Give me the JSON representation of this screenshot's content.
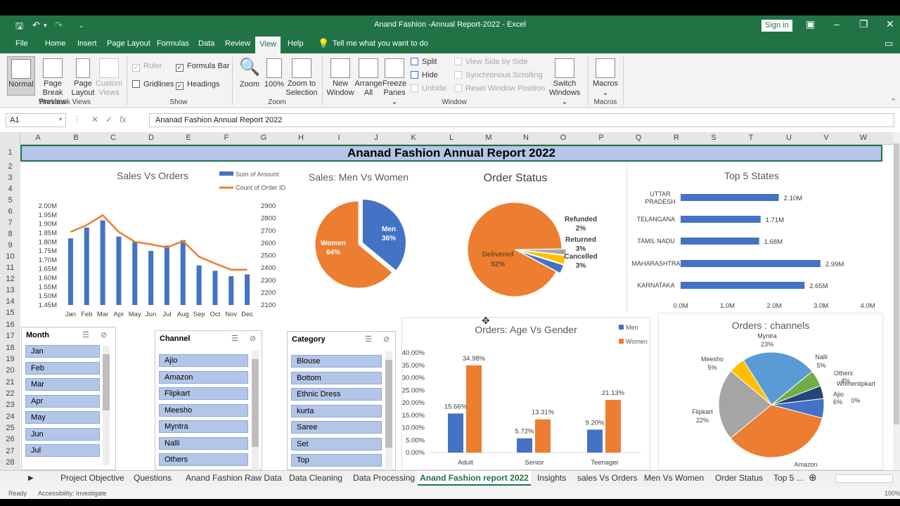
{
  "window": {
    "title": "Anand Fashion -Annual Report-2022  -  Excel",
    "sign_in": "Sign in"
  },
  "ribbon_tabs": [
    "File",
    "Home",
    "Insert",
    "Page Layout",
    "Formulas",
    "Data",
    "Review",
    "View",
    "Help"
  ],
  "tell_me": "Tell me what you want to do",
  "ribbon": {
    "normal": "Normal",
    "page_break_1": "Page Break",
    "page_break_2": "Preview",
    "page_layout_1": "Page",
    "page_layout_2": "Layout",
    "custom_views_1": "Custom",
    "custom_views_2": "Views",
    "workbook_views": "Workbook Views",
    "ruler": "Ruler",
    "formula_bar": "Formula Bar",
    "gridlines": "Gridlines",
    "headings": "Headings",
    "show": "Show",
    "zoom": "Zoom",
    "zoom100": "100%",
    "zoom_sel_1": "Zoom to",
    "zoom_sel_2": "Selection",
    "zoom_group": "Zoom",
    "new_window_1": "New",
    "new_window_2": "Window",
    "arrange_1": "Arrange",
    "arrange_2": "All",
    "freeze_1": "Freeze",
    "freeze_2": "Panes ⌄",
    "split": "Split",
    "hide": "Hide",
    "unhide": "Unhide",
    "side_by_side": "View Side by Side",
    "sync_scroll": "Synchronous Scrolling",
    "reset_pos": "Reset Window Position",
    "switch_1": "Switch",
    "switch_2": "Windows ⌄",
    "window_group": "Window",
    "macros": "Macros",
    "macros_group": "Macros"
  },
  "formula_bar": {
    "name_box": "A1",
    "formula": "Ananad Fashion Annual Report 2022"
  },
  "columns": [
    "A",
    "B",
    "C",
    "D",
    "E",
    "F",
    "G",
    "H",
    "I",
    "J",
    "K",
    "L",
    "M",
    "N",
    "O",
    "P",
    "Q",
    "R",
    "S",
    "T",
    "U",
    "V",
    "W"
  ],
  "rows": [
    "1",
    "2",
    "3",
    "4",
    "5",
    "6",
    "7",
    "8",
    "9",
    "10",
    "11",
    "12",
    "13",
    "14",
    "15",
    "16",
    "17",
    "18",
    "19",
    "20",
    "21",
    "22",
    "23",
    "24",
    "25",
    "26",
    "27",
    "28"
  ],
  "banner": "Ananad Fashion Annual Report 2022",
  "chart_data": [
    {
      "type": "bar+line",
      "title": "Sales Vs Orders",
      "categories": [
        "Jan",
        "Feb",
        "Mar",
        "Apr",
        "May",
        "Jun",
        "Jul",
        "Aug",
        "Sep",
        "Oct",
        "Nov",
        "Dec"
      ],
      "series": [
        {
          "name": "Sum of Amount",
          "type": "bar",
          "values": [
            1.82,
            1.88,
            1.92,
            1.83,
            1.8,
            1.75,
            1.78,
            1.81,
            1.67,
            1.64,
            1.61,
            1.62
          ]
        },
        {
          "name": "Count of Order ID",
          "type": "line",
          "axis": "right",
          "values": [
            2690,
            2745,
            2825,
            2690,
            2610,
            2590,
            2565,
            2615,
            2490,
            2435,
            2385,
            2385
          ]
        }
      ],
      "yticks_left": [
        "2.00M",
        "1.95M",
        "1.90M",
        "1.85M",
        "1.80M",
        "1.75M",
        "1.70M",
        "1.65M",
        "1.60M",
        "1.55M",
        "1.50M",
        "1.45M"
      ],
      "yticks_right": [
        "2900",
        "2800",
        "2700",
        "2600",
        "2500",
        "2400",
        "2300",
        "2200",
        "2100"
      ]
    },
    {
      "type": "pie",
      "title": "Sales: Men Vs Women",
      "slices": [
        {
          "label": "Men",
          "value": 36,
          "text": "36%",
          "color": "#4472c4"
        },
        {
          "label": "Women",
          "value": 64,
          "text": "64%",
          "color": "#ed7d31"
        }
      ]
    },
    {
      "type": "pie",
      "title": "Order Status",
      "slices": [
        {
          "label": "Delivered",
          "value": 92,
          "text": "92%",
          "color": "#ed7d31"
        },
        {
          "label": "Refunded",
          "value": 2,
          "text": "2%",
          "color": "#a5a5a5"
        },
        {
          "label": "Returned",
          "value": 3,
          "text": "3%",
          "color": "#ffc000"
        },
        {
          "label": "Cancelled",
          "value": 3,
          "text": "3%",
          "color": "#4472c4"
        }
      ]
    },
    {
      "type": "bar",
      "orientation": "horizontal",
      "title": "Top 5 States",
      "categories": [
        "UTTAR PRADESH",
        "TELANGANA",
        "TAMIL NADU",
        "MAHARASHTRA",
        "KARNATAKA"
      ],
      "values": [
        2.1,
        1.71,
        1.68,
        2.99,
        2.65
      ],
      "labels": [
        "2.10M",
        "1.71M",
        "1.68M",
        "2.99M",
        "2.65M"
      ],
      "xticks": [
        "0.0M",
        "1.0M",
        "2.0M",
        "3.0M",
        "4.0M"
      ],
      "xlim": [
        0,
        4
      ]
    },
    {
      "type": "bar",
      "title": "Orders: Age Vs Gender",
      "categories": [
        "Adult",
        "Senior",
        "Teenager"
      ],
      "series": [
        {
          "name": "Men",
          "values": [
            15.66,
            5.72,
            9.2
          ],
          "labels": [
            "15.66%",
            "5.72%",
            "9.20%"
          ]
        },
        {
          "name": "Women",
          "values": [
            34.98,
            13.31,
            21.13
          ],
          "labels": [
            "34.98%",
            "13.31%",
            "21.13%"
          ]
        }
      ],
      "yticks": [
        "40.00%",
        "35.00%",
        "30.00%",
        "25.00%",
        "20.00%",
        "15.00%",
        "10.00%",
        "5.00%",
        "0.00%"
      ],
      "ylim": [
        0,
        40
      ]
    },
    {
      "type": "pie",
      "title": "Orders : channels",
      "slices": [
        {
          "label": "Myntra",
          "value": 23,
          "text": "23%",
          "color": "#5b9bd5"
        },
        {
          "label": "Nalli",
          "value": 5,
          "text": "5%",
          "color": "#70ad47"
        },
        {
          "label": "Others",
          "value": 4,
          "text": "4%",
          "color": "#264478"
        },
        {
          "label": "Ajio",
          "value": 6,
          "text": "6%",
          "color": "#4472c4"
        },
        {
          "label": "Womenlipkart",
          "value": 0,
          "text": "0%",
          "color": "#9e480e"
        },
        {
          "label": "Amazon",
          "value": 35,
          "text": "35%",
          "color": "#ed7d31"
        },
        {
          "label": "Flipkart",
          "value": 22,
          "text": "22%",
          "color": "#a5a5a5"
        },
        {
          "label": "Meesho",
          "value": 5,
          "text": "5%",
          "color": "#ffc000"
        }
      ]
    }
  ],
  "slicers": {
    "month": {
      "title": "Month",
      "items": [
        "Jan",
        "Feb",
        "Mar",
        "Apr",
        "May",
        "Jun",
        "Jul"
      ]
    },
    "channel": {
      "title": "Channel",
      "items": [
        "Ajio",
        "Amazon",
        "Flipkart",
        "Meesho",
        "Myntra",
        "Nalli",
        "Others"
      ]
    },
    "category": {
      "title": "Category",
      "items": [
        "Blouse",
        "Bottom",
        "Ethnic Dress",
        "kurta",
        "Saree",
        "Set",
        "Top"
      ]
    }
  },
  "sheet_tabs": [
    "Project Objective",
    "Questions",
    "Anand Fashion Raw Data",
    "Data Cleaning",
    "Data Processing",
    "Anand Fashion report 2022",
    "Insights",
    "sales Vs Orders",
    "Men Vs Women",
    "Order Status",
    "Top 5 ..."
  ],
  "status": {
    "ready": "Ready",
    "accessibility": "Accessibility: Investigate",
    "zoom": "100%"
  }
}
